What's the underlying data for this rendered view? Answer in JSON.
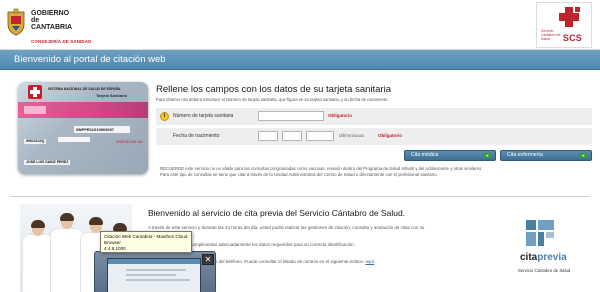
{
  "header": {
    "gov_lines": [
      "GOBIERNO",
      "de",
      "CANTABRIA"
    ],
    "gov_dept": "CONSEJERÍA DE SANIDAD",
    "scs_logo_text": "SCS",
    "scs_small_text": "Servicio Cántabro de Salud"
  },
  "title_bar": {
    "title": "Bienvenido al portal de citación web"
  },
  "card": {
    "title": "SISTEMA NACIONAL DE SALUD DE ESPAÑA",
    "subtitle": "Tarjeta Sanitaria",
    "number": "SNPPR11010903007",
    "name": "JOSE LUIS SAINZ PEREZ",
    "code": "99510133Q",
    "valid": "URGENCIAS 061"
  },
  "form": {
    "heading": "Rellene los campos con los datos de su tarjeta sanitaria",
    "intro": "Para obtener cita deberá introducir el Número de tarjeta sanitaria, que figura en su tarjeta sanitaria, y su fecha de nacimiento.",
    "card_label": "Número de tarjeta sanitaria",
    "card_value": "",
    "required": "Obligatorio",
    "birth_label": "Fecha de nacimiento",
    "birth_day": "",
    "birth_month": "",
    "birth_year": "",
    "date_hint": "dd/mm/aaaa",
    "info_icon": "i"
  },
  "buttons": {
    "medica": "Cita médica",
    "enfermeria": "Cita enfermería"
  },
  "notes": [
    "RECUERDE este servicio no es válido para las consultas programadas como vacunas, revisión dentro del Programa de Salud Infantil y del Adolescente y otras similares.",
    "Para este tipo de consultas se tiene que citar a través de la Unidad Administrativa del Centro de Salud o directamente con el profesional sanitario."
  ],
  "lower": {
    "heading": "Bienvenido al servicio de cita previa del Servicio Cántabro de Salud.",
    "text1": "A través de este servicio y durante las 24 horas del día, usted podrá realizar las gestiones de citación, consulta y anulación de citas con su",
    "text2": "tarjeta sanitaria para cumplimentar adecuadamente los datos requeridos para su correcta identificación.",
    "text3": "Puede pedir su cita previa a través del teléfono. Puede consultar el listado de centros en el siguiente enlace:",
    "link": "aquí"
  },
  "cita_logo": {
    "word_a": "cita",
    "word_b": "previa",
    "sub": "Servicio Cántabro de Salud"
  },
  "tooltip": {
    "line1": "Citación Web Cantabria - Maxthon Cloud Browser",
    "line2": "4.4.8.1000"
  },
  "preview": {
    "close": "✕"
  },
  "colors": {
    "title_bar": "#4f87ad",
    "button": "#3d6f92",
    "required": "#c41f2f",
    "brand_red": "#c0242f"
  }
}
